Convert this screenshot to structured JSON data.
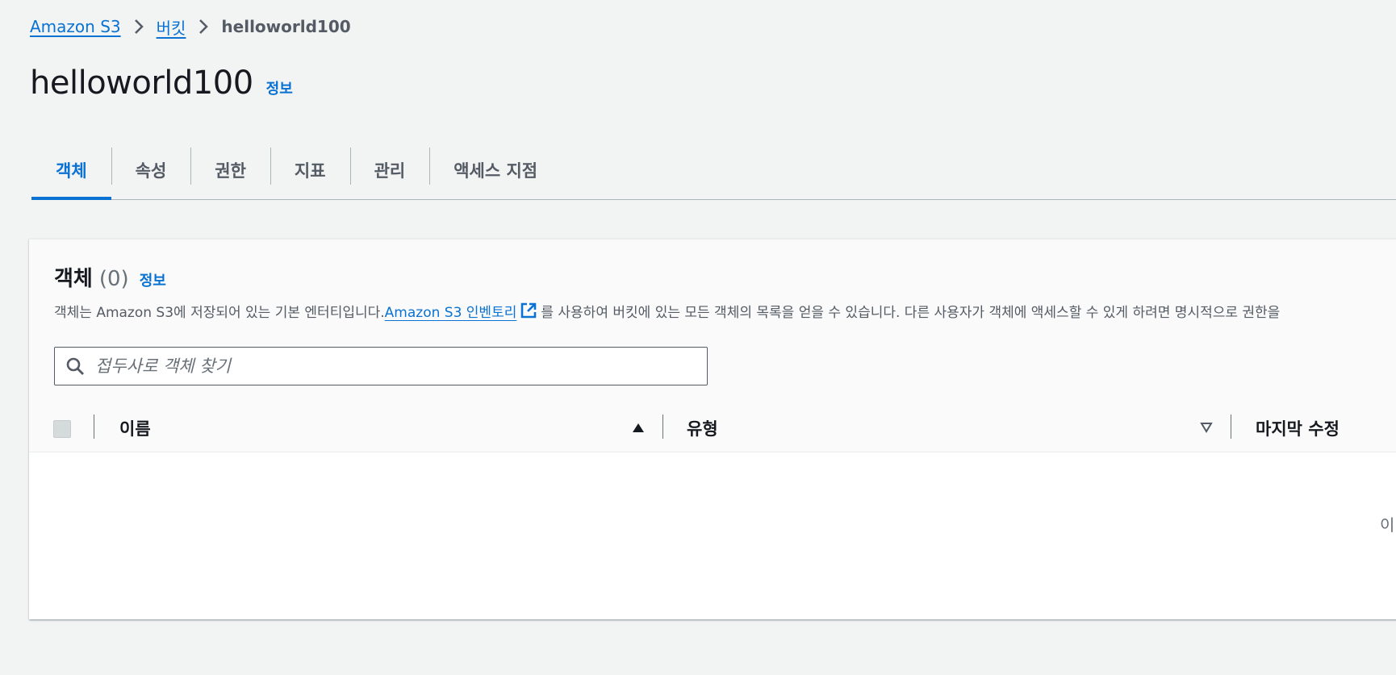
{
  "breadcrumb": {
    "items": [
      "Amazon S3",
      "버킷"
    ],
    "current": "helloworld100"
  },
  "header": {
    "title": "helloworld100",
    "info": "정보"
  },
  "tabs": [
    "객체",
    "속성",
    "권한",
    "지표",
    "관리",
    "액세스 지점"
  ],
  "active_tab": "객체",
  "objects": {
    "title": "객체",
    "count": "(0)",
    "info": "정보",
    "description_before": "객체는 Amazon S3에 저장되어 있는 기본 엔터티입니다.",
    "description_link": "Amazon S3 인벤토리",
    "description_after": "를 사용하여 버킷에 있는 모든 객체의 목록을 얻을 수 있습니다. 다른 사용자가 객체에 액세스할 수 있게 하려면 명시적으로 권한을",
    "search_placeholder": "접두사로 객체 찾기",
    "columns": {
      "name": "이름",
      "type": "유형",
      "last_modified": "마지막 수정"
    },
    "empty_text": "이"
  },
  "icons": {
    "breadcrumb_separator": "chevron-right-icon",
    "external_link": "external-link-icon",
    "search": "search-icon",
    "sort_asc": "sort-ascending-icon",
    "sort_none": "sort-icon"
  },
  "colors": {
    "link": "#0972d3",
    "background": "#f2f3f3",
    "text": "#16191f",
    "muted": "#545b64"
  }
}
